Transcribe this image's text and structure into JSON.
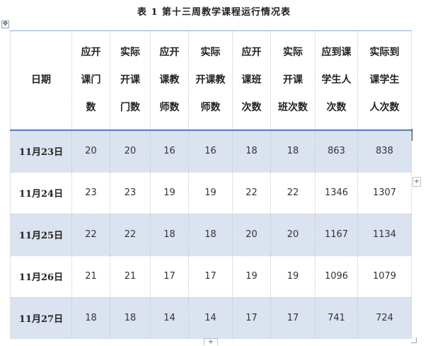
{
  "document": {
    "title": "表 1 第十三周教学课程运行情况表"
  },
  "table": {
    "headers": [
      [
        "日期"
      ],
      [
        "应开",
        "课门",
        "数"
      ],
      [
        "实际",
        "开课",
        "门数"
      ],
      [
        "应开",
        "课教",
        "师数"
      ],
      [
        "实际",
        "开课教",
        "师数"
      ],
      [
        "应开",
        "课班",
        "次数"
      ],
      [
        "实际",
        "开课",
        "班次数"
      ],
      [
        "应到课",
        "学生人",
        "次数"
      ],
      [
        "实际到",
        "课学生",
        "人次数"
      ]
    ],
    "rows": [
      [
        "11月23日",
        "20",
        "20",
        "16",
        "16",
        "18",
        "18",
        "863",
        "838"
      ],
      [
        "11月24日",
        "23",
        "23",
        "19",
        "19",
        "22",
        "22",
        "1346",
        "1307"
      ],
      [
        "11月25日",
        "22",
        "22",
        "18",
        "18",
        "20",
        "20",
        "1167",
        "1134"
      ],
      [
        "11月26日",
        "21",
        "21",
        "17",
        "17",
        "19",
        "19",
        "1096",
        "1079"
      ],
      [
        "11月27日",
        "18",
        "18",
        "14",
        "14",
        "17",
        "17",
        "741",
        "724"
      ]
    ]
  },
  "controls": {
    "move_handle_icon": "move-icon",
    "add_column_icon": "plus-icon",
    "add_row_icon": "plus-icon",
    "resize_handle_icon": "resize-icon",
    "shade_color": "#dbe3f0",
    "accent_color": "#4f7ec2"
  }
}
